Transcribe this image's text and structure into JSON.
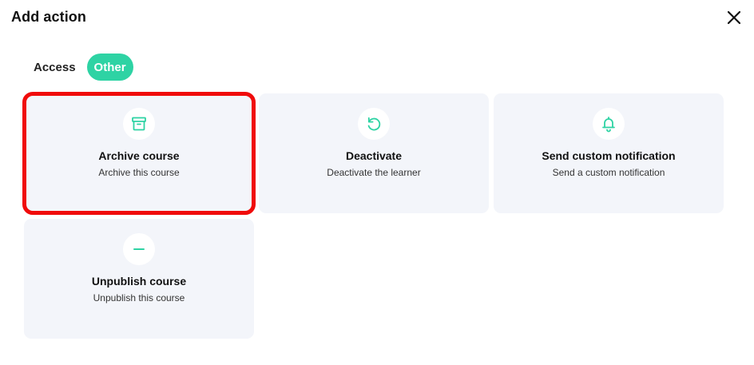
{
  "modal": {
    "title": "Add action",
    "close_icon": "close-icon"
  },
  "tabs": [
    {
      "label": "Access",
      "active": false
    },
    {
      "label": "Other",
      "active": true
    }
  ],
  "cards": [
    {
      "title": "Archive course",
      "description": "Archive this course",
      "icon": "archive-box-icon",
      "selected": true
    },
    {
      "title": "Deactivate",
      "description": "Deactivate the learner",
      "icon": "undo-arrow-icon",
      "selected": false
    },
    {
      "title": "Send custom notification",
      "description": "Send a custom notification",
      "icon": "bell-icon",
      "selected": false
    },
    {
      "title": "Unpublish course",
      "description": "Unpublish this course",
      "icon": "minus-icon",
      "selected": false
    }
  ],
  "colors": {
    "accent": "#2ed3a4",
    "card_background": "#f3f5fa",
    "selection_outline": "#f00b0b"
  }
}
